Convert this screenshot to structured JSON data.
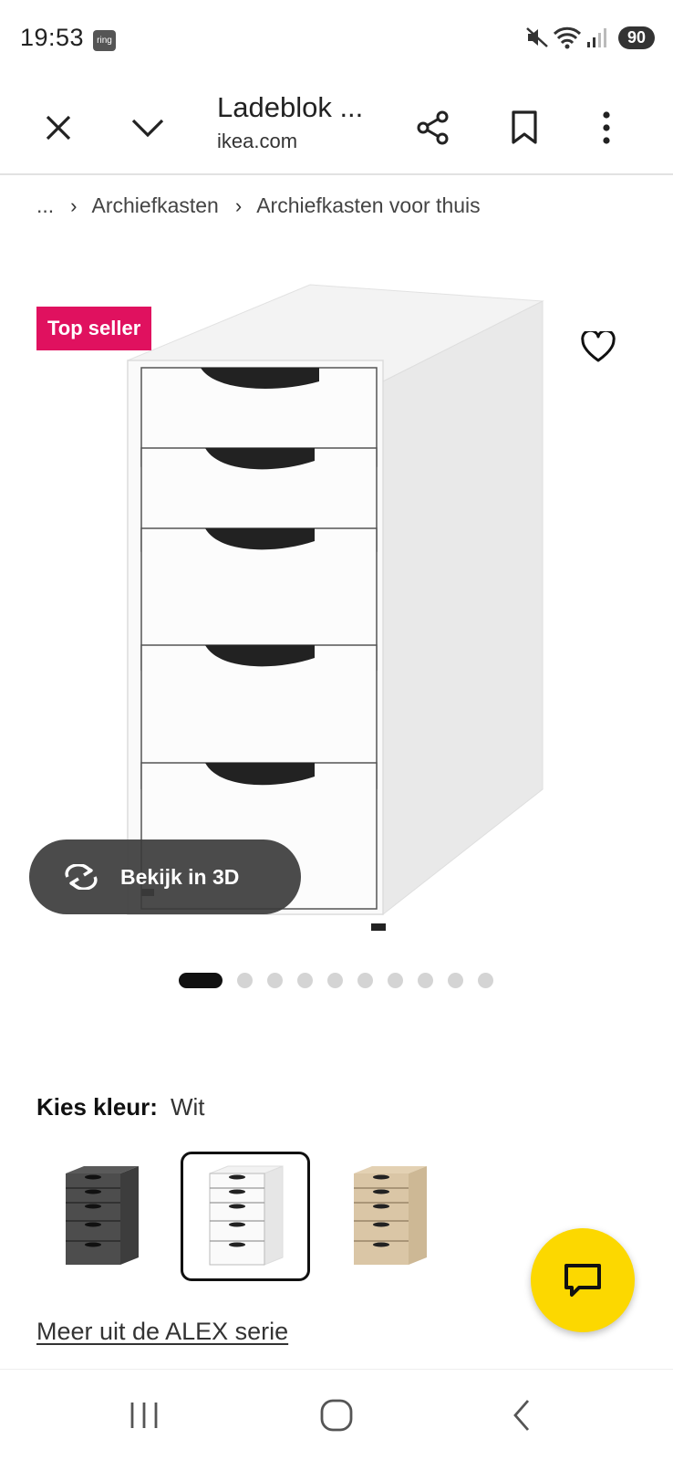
{
  "status_bar": {
    "time": "19:53",
    "app_badge": "ring",
    "battery": "90",
    "icons": [
      "mute-icon",
      "wifi-icon",
      "signal-icon"
    ]
  },
  "browser": {
    "title": "Ladeblok ...",
    "domain": "ikea.com",
    "icons": [
      "close-icon",
      "chevron-down-icon",
      "share-icon",
      "bookmark-icon",
      "more-vert-icon"
    ]
  },
  "breadcrumb": {
    "ellipsis": "...",
    "items": [
      "Archiefkasten",
      "Archiefkasten voor thuis"
    ]
  },
  "product": {
    "badge": "Top seller",
    "view_3d_label": "Bekijk in 3D",
    "image_count": 10,
    "active_image_index": 0
  },
  "color": {
    "label": "Kies kleur:",
    "value": "Wit",
    "options": [
      {
        "name": "dark-grey",
        "hex": "#4d4d4d",
        "selected": false
      },
      {
        "name": "white",
        "hex": "#f4f4f4",
        "selected": true
      },
      {
        "name": "oak",
        "hex": "#d9c4a4",
        "selected": false
      }
    ]
  },
  "series_link": "Meer uit de ALEX serie",
  "colors": {
    "badge_bg": "#e0115f",
    "fab_bg": "#fcd800"
  }
}
